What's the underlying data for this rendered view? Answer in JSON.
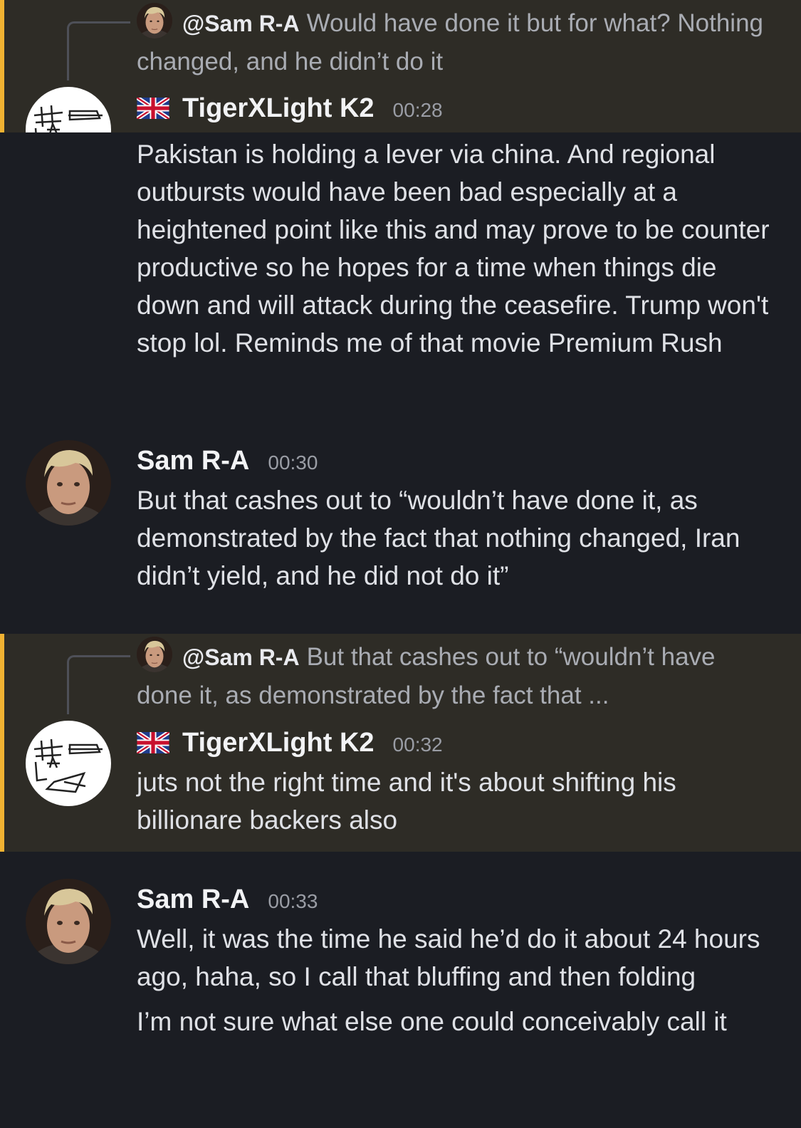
{
  "colors": {
    "background": "#1b1d23",
    "highlight_background": "#2e2c26",
    "mention_bar": "#f0b232",
    "text": "#dfe1e6",
    "muted_text": "#a9acb3"
  },
  "messages": [
    {
      "reply": {
        "icon": "sam-avatar",
        "author": "@Sam R-A",
        "text": "Would have done it but for what? Nothing changed, and he didn’t do it"
      },
      "avatar": "tigerxlight-avatar",
      "flag": "uk-flag-icon",
      "author": "TigerXLight K2",
      "time": "00:28",
      "text": "Pakistan is holding a lever via china. And regional outbursts would have been bad especially at a heightened point like this and may prove to be counter productive so he hopes for a time when things die down and will attack during the ceasefire. Trump won't stop lol. Reminds me of that movie Premium Rush"
    },
    {
      "avatar": "sam-avatar",
      "author": "Sam R-A",
      "time": "00:30",
      "text": "But that cashes out to “wouldn’t have done it, as demonstrated by the fact that nothing changed, Iran didn’t yield, and he did not do it”"
    },
    {
      "reply": {
        "icon": "sam-avatar",
        "author": "@Sam R-A",
        "text": "But that cashes out to “wouldn’t have done it, as demonstrated by the fact that ..."
      },
      "avatar": "tigerxlight-avatar",
      "flag": "uk-flag-icon",
      "author": "TigerXLight K2",
      "time": "00:32",
      "text": "juts not the right time and it's about shifting his billionare backers also"
    },
    {
      "avatar": "sam-avatar",
      "author": "Sam R-A",
      "time": "00:33",
      "text": "Well, it was the time he said he’d do it about 24 hours ago, haha, so I call that bluffing and then folding",
      "text2": "I’m not sure what else one could conceivably call it"
    }
  ]
}
